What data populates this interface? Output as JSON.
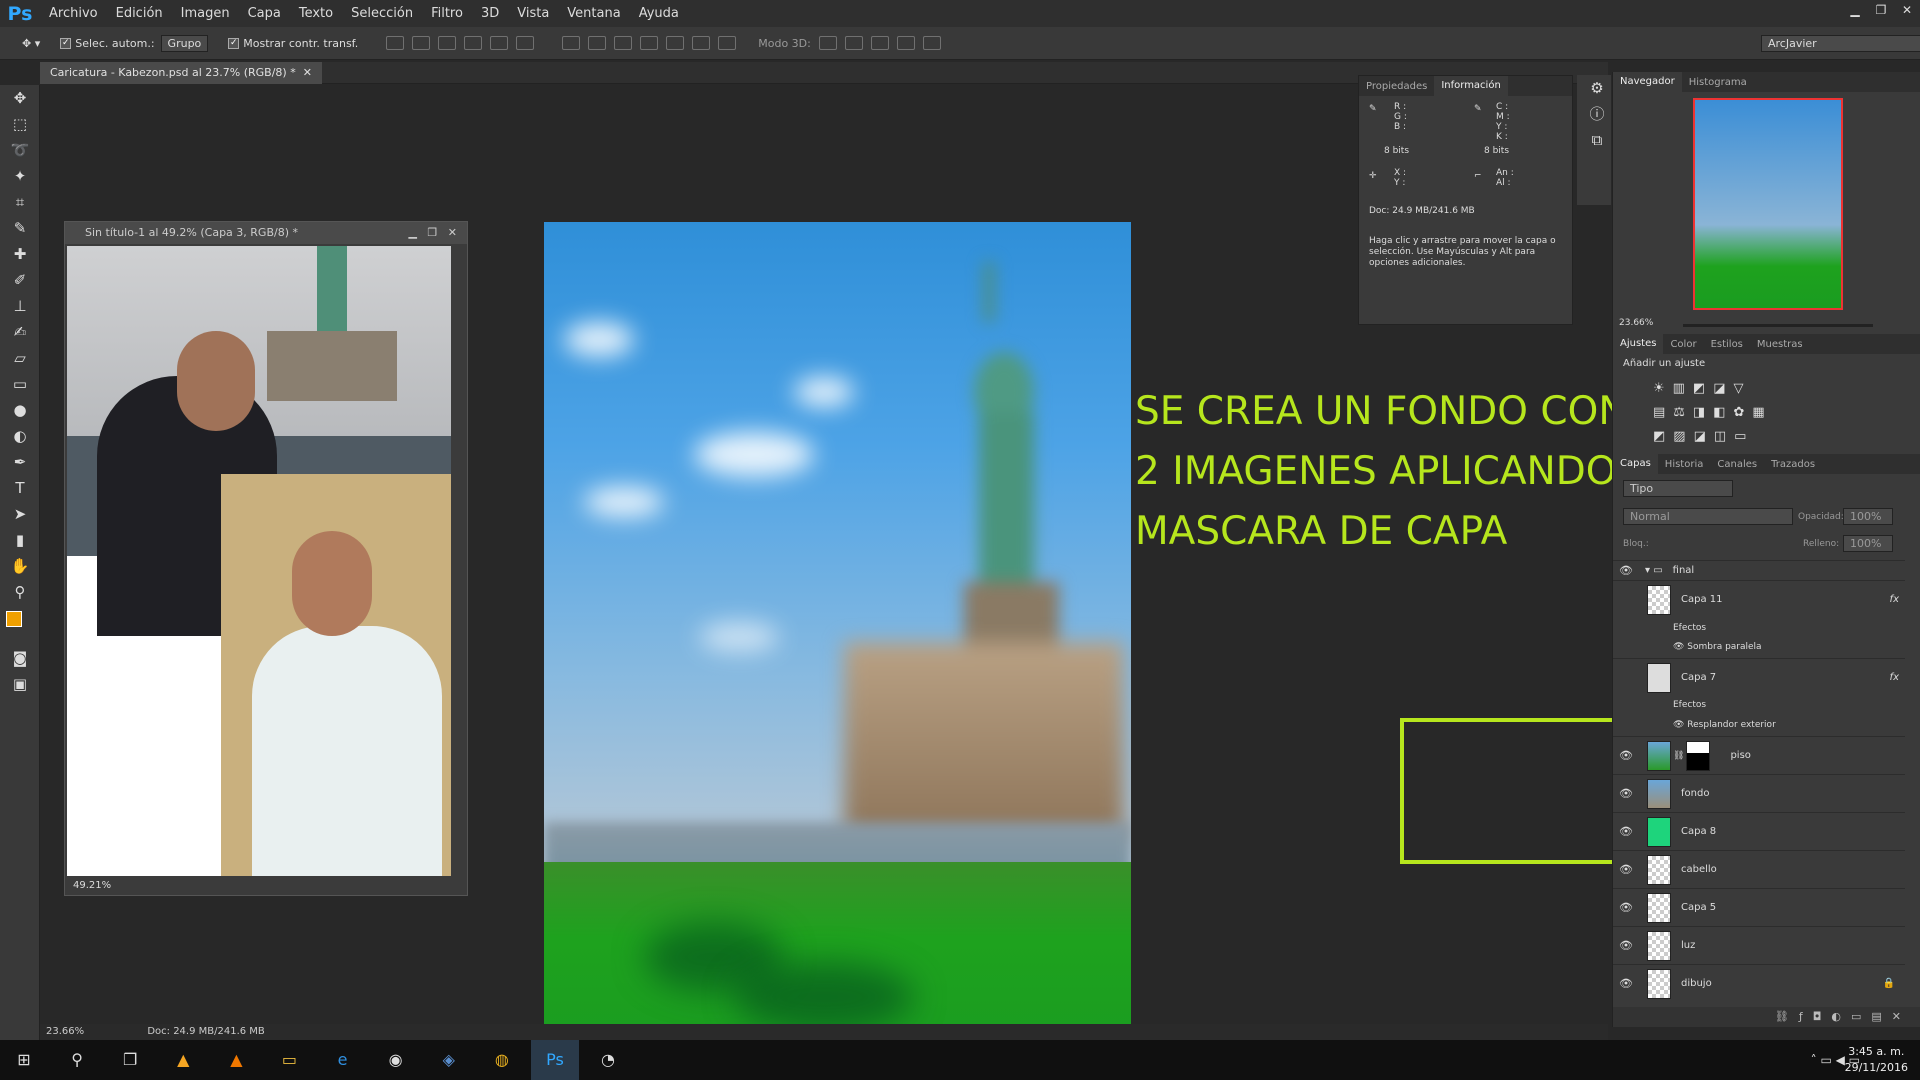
{
  "app": {
    "logo": "Ps"
  },
  "menu": [
    "Archivo",
    "Edición",
    "Imagen",
    "Capa",
    "Texto",
    "Selección",
    "Filtro",
    "3D",
    "Vista",
    "Ventana",
    "Ayuda"
  ],
  "options": {
    "auto_select": "Selec. autom.:",
    "group": "Grupo",
    "transform": "Mostrar contr. transf.",
    "mode3d": "Modo 3D:",
    "workspace": "ArcJavier"
  },
  "doc_tab": "Caricatura - Kabezon.psd al 23.7% (RGB/8) *",
  "caption": [
    "SE CREA UN FONDO CON",
    "2 IMAGENES APLICANDO",
    "MASCARA DE CAPA"
  ],
  "floating": {
    "title": "Sin título-1 al 49.2% (Capa 3, RGB/8) *",
    "zoom": "49.21%"
  },
  "info": {
    "tabs": [
      "Propiedades",
      "Información"
    ],
    "rgb": [
      "R :",
      "G :",
      "B :"
    ],
    "cmyk": [
      "C :",
      "M :",
      "Y :",
      "K :"
    ],
    "bits": "8 bits",
    "xy": [
      "X :",
      "Y :"
    ],
    "wh": [
      "An :",
      "Al :"
    ],
    "doc": "Doc: 24.9 MB/241.6 MB",
    "hint": "Haga clic y arrastre para mover la capa o selección. Use Mayúsculas y Alt para opciones adicionales."
  },
  "navigator": {
    "tabs": [
      "Navegador",
      "Histograma"
    ],
    "zoom": "23.66%"
  },
  "adjust": {
    "tabs": [
      "Ajustes",
      "Color",
      "Estilos",
      "Muestras"
    ],
    "title": "Añadir un ajuste"
  },
  "layers_panel": {
    "tabs": [
      "Capas",
      "Historia",
      "Canales",
      "Trazados"
    ],
    "kind": "Tipo",
    "blend": "Normal",
    "opacity_label": "Opacidad:",
    "opacity": "100%",
    "lock_label": "Bloq.:",
    "fill_label": "Relleno:",
    "fill": "100%",
    "group": "final",
    "layers": [
      {
        "name": "Capa 11",
        "fx": "fx",
        "effects_label": "Efectos",
        "effect": "Sombra paralela"
      },
      {
        "name": "Capa 7",
        "fx": "fx",
        "effects_label": "Efectos",
        "effect": "Resplandor exterior"
      },
      {
        "name": "piso"
      },
      {
        "name": "fondo"
      },
      {
        "name": "Capa 8"
      },
      {
        "name": "cabello"
      },
      {
        "name": "Capa 5"
      },
      {
        "name": "luz"
      },
      {
        "name": "dibujo"
      }
    ]
  },
  "status": {
    "zoom": "23.66%",
    "doc": "Doc: 24.9 MB/241.6 MB"
  },
  "clock": {
    "time": "3:45 a. m.",
    "date": "29/11/2016"
  },
  "colors": {
    "accent": "#b6e61d",
    "fg": "#f0a000",
    "bg": "#000000"
  }
}
